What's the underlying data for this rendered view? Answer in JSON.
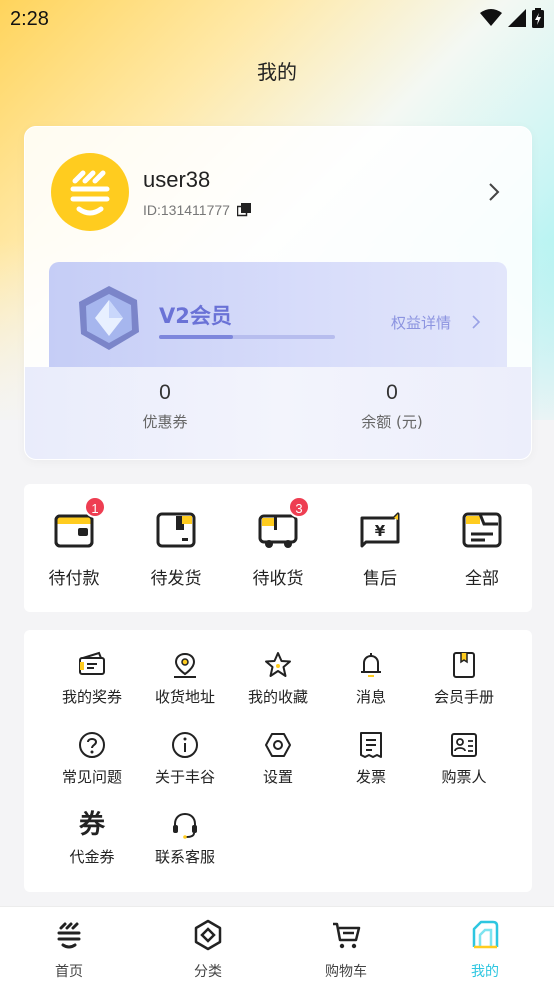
{
  "status_bar": {
    "time": "2:28",
    "icons": [
      "wifi-icon",
      "signal-icon",
      "battery-charging-icon"
    ]
  },
  "page_title": "我的",
  "profile": {
    "username": "user38",
    "user_id": "ID:131411777",
    "avatar_icon": "brand-logo-icon",
    "brand_color": "#ffcc1f"
  },
  "membership": {
    "level": "V2会员",
    "benefits_link": "权益详情",
    "progress": 0.42,
    "accent_color": "#6a72d6"
  },
  "stats": [
    {
      "value": "0",
      "label": "优惠券"
    },
    {
      "value": "0",
      "label": "余额 (元)"
    }
  ],
  "orders": [
    {
      "label": "待付款",
      "icon": "wallet-icon",
      "badge": "1"
    },
    {
      "label": "待发货",
      "icon": "package-icon",
      "badge": ""
    },
    {
      "label": "待收货",
      "icon": "delivery-truck-icon",
      "badge": "3"
    },
    {
      "label": "售后",
      "icon": "refund-yuan-icon",
      "badge": ""
    },
    {
      "label": "全部",
      "icon": "all-orders-icon",
      "badge": ""
    }
  ],
  "badge_color": "#ee3e52",
  "services": [
    {
      "label": "我的奖券",
      "icon": "ticket-icon"
    },
    {
      "label": "收货地址",
      "icon": "map-pin-icon"
    },
    {
      "label": "我的收藏",
      "icon": "star-icon"
    },
    {
      "label": "消息",
      "icon": "bell-icon"
    },
    {
      "label": "会员手册",
      "icon": "handbook-icon"
    },
    {
      "label": "常见问题",
      "icon": "question-icon"
    },
    {
      "label": "关于丰谷",
      "icon": "info-icon"
    },
    {
      "label": "设置",
      "icon": "settings-hexagon-icon"
    },
    {
      "label": "发票",
      "icon": "invoice-icon"
    },
    {
      "label": "购票人",
      "icon": "id-card-icon"
    },
    {
      "label": "代金券",
      "icon": "voucher-icon",
      "glyph": "券"
    },
    {
      "label": "联系客服",
      "icon": "headset-icon"
    }
  ],
  "tabs": [
    {
      "label": "首页",
      "icon": "home-logo-icon",
      "active": false
    },
    {
      "label": "分类",
      "icon": "category-icon",
      "active": false
    },
    {
      "label": "购物车",
      "icon": "cart-icon",
      "active": false
    },
    {
      "label": "我的",
      "icon": "profile-icon",
      "active": true
    }
  ],
  "active_tab_color": "#2ec6e0"
}
